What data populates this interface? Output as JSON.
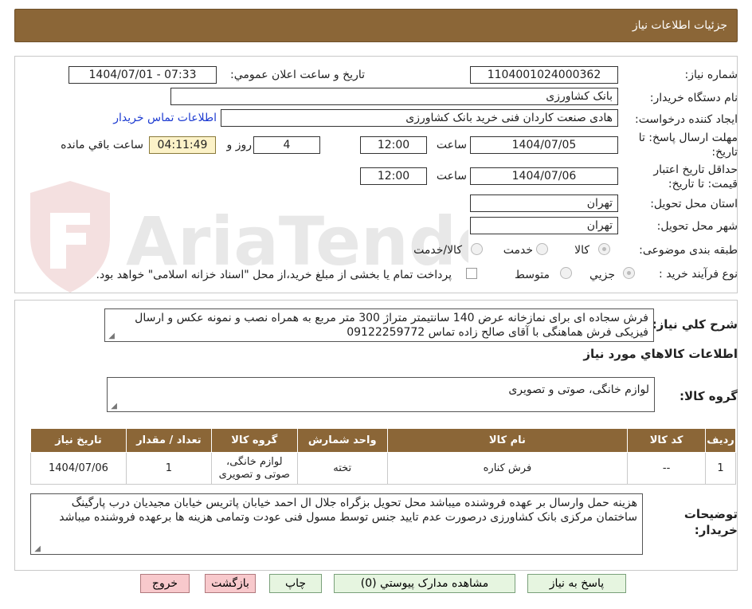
{
  "header": {
    "title": "جزئیات اطلاعات نیاز"
  },
  "form": {
    "need_number_label": "شماره نیاز:",
    "need_number": "1104001024000362",
    "announce_label": "تاریخ و ساعت اعلان عمومي:",
    "announce_value": "1404/07/01 - 07:33",
    "buyer_org_label": "نام دستگاه خريدار:",
    "buyer_org": "بانک کشاورزی",
    "requester_label": "ايجاد کننده درخواست:",
    "requester": "هادی صنعت کاردان فنی خرید بانک کشاورزی",
    "contact_link": "اطلاعات تماس خريدار",
    "deadline_label_1": "مهلت ارسال پاسخ: تا",
    "deadline_label_2": "تاریخ:",
    "deadline_date": "1404/07/05",
    "time_label": "ساعت",
    "deadline_time": "12:00",
    "days_value": "4",
    "days_label": "روز و",
    "remaining_time": "04:11:49",
    "remaining_label": "ساعت باقي مانده",
    "validity_label_1": "حداقل تاريخ اعتبار",
    "validity_label_2": "قيمت: تا تاريخ:",
    "validity_date": "1404/07/06",
    "validity_time": "12:00",
    "province_label": "استان محل تحويل:",
    "province": "تهران",
    "city_label": "شهر محل تحويل:",
    "city": "تهران",
    "category_label": "طبقه بندی موضوعی:",
    "category_options": [
      "کالا",
      "خدمت",
      "کالا/خدمت"
    ],
    "process_label": "نوع فرآيند خريد :",
    "process_options": [
      "جزيي",
      "متوسط"
    ],
    "payment_note": "پرداخت تمام یا بخشی از مبلغ خرید،از محل \"اسناد خزانه اسلامی\" خواهد بود."
  },
  "description": {
    "label": "شرح کلي نياز:",
    "text": "فرش سجاده ای برای نمازخانه عرض 140 سانتیمتر متراژ 300 متر مربع به همراه نصب و نمونه عکس و ارسال فیزیکی فرش هماهنگی با آقای صالح زاده تماس 09122259772"
  },
  "goods": {
    "section_title": "اطلاعات کالاهاي مورد نياز",
    "group_label": "گروه کالا:",
    "group_value": "لوازم خانگی، صوتی و تصویری",
    "columns": [
      "رديف",
      "کد کالا",
      "نام کالا",
      "واحد شمارش",
      "گروه کالا",
      "تعداد / مقدار",
      "تاريخ نياز"
    ],
    "rows": [
      [
        "1",
        "--",
        "فرش کناره",
        "تخته",
        "لوازم خانگی، صوتی و تصویری",
        "1",
        "1404/07/06"
      ]
    ]
  },
  "buyer_notes": {
    "label_1": "توضيحات",
    "label_2": "خريدار:",
    "text": "هزینه حمل وارسال بر عهده فروشنده میباشد محل تحویل بزگراه جلال ال احمد خیابان پاتریس خیابان مجیدیان درب پارگینگ ساختمان مرکزی بانک کشاورزی درصورت عدم تایید جنس توسط مسول فنی عودت وتمامی هزینه ها برعهده فروشنده میباشد"
  },
  "buttons": {
    "reply": "پاسخ به نياز",
    "attachments": "مشاهده مدارک پيوستي (0)",
    "print": "چاپ",
    "back": "بازگشت",
    "exit": "خروج"
  },
  "watermark": {
    "logo_text": "AriaTender.neT"
  },
  "colors": {
    "header_bg": "#8b6637",
    "link": "#1d3bd1",
    "remaining_bg": "#fcf2c8",
    "button_green": "#e6f5e0",
    "button_pink": "#f8c9cc"
  }
}
